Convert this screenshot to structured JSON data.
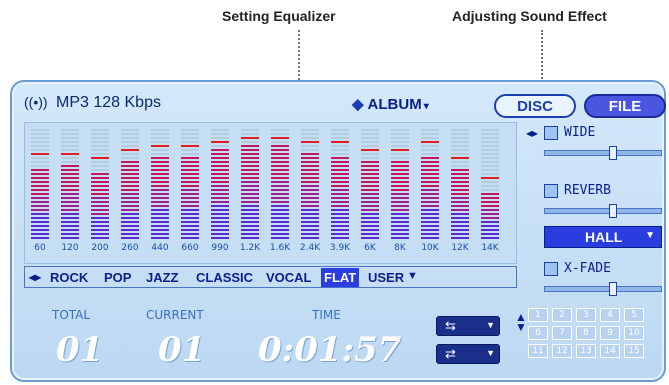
{
  "callouts": {
    "equalizer": "Setting Equalizer",
    "sound_effect": "Adjusting Sound Effect"
  },
  "header": {
    "format": "MP3 128 Kbps",
    "source_icon": "broadcast-icon",
    "album_label": "ALBUM",
    "disc_label": "DISC",
    "file_label": "FILE"
  },
  "equalizer": {
    "frequencies": [
      "60",
      "120",
      "200",
      "260",
      "440",
      "660",
      "990",
      "1.2K",
      "1.6K",
      "2.4K",
      "3.9K",
      "6K",
      "8K",
      "10K",
      "12K",
      "14K"
    ],
    "levels": [
      0.66,
      0.68,
      0.62,
      0.7,
      0.74,
      0.74,
      0.82,
      0.86,
      0.86,
      0.78,
      0.76,
      0.72,
      0.72,
      0.76,
      0.64,
      0.42
    ],
    "peaks": [
      0.74,
      0.76,
      0.7,
      0.78,
      0.82,
      0.82,
      0.86,
      0.9,
      0.9,
      0.86,
      0.84,
      0.8,
      0.8,
      0.84,
      0.72,
      0.52
    ]
  },
  "presets": {
    "items": [
      "ROCK",
      "POP",
      "JAZZ",
      "CLASSIC",
      "VOCAL",
      "FLAT",
      "USER"
    ],
    "selected": "FLAT"
  },
  "effects": {
    "wide_label": "WIDE",
    "reverb_label": "REVERB",
    "reverb_mode": "HALL",
    "xfade_label": "X-FADE",
    "wide_level": 0.5,
    "reverb_level": 0.5,
    "xfade_level": 0.5
  },
  "display": {
    "total_label": "TOTAL",
    "current_label": "CURRENT",
    "time_label": "TIME",
    "total": "01",
    "current": "01",
    "time": "0:01:57"
  },
  "repeat": {
    "repeat_glyph": "⇆",
    "shuffle_glyph": "⇄"
  },
  "disc_numbers": [
    "1",
    "2",
    "3",
    "4",
    "5",
    "6",
    "7",
    "8",
    "9",
    "10",
    "11",
    "12",
    "13",
    "14",
    "15"
  ]
}
